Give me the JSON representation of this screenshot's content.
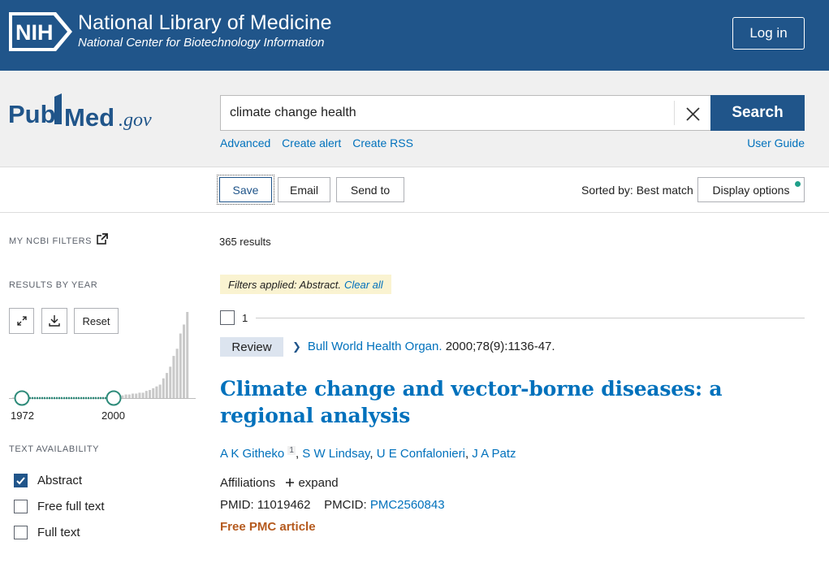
{
  "header": {
    "org_title": "National Library of Medicine",
    "org_subtitle": "National Center for Biotechnology Information",
    "login_label": "Log in",
    "nih_logo_text": "NIH"
  },
  "search": {
    "logo_text": "PubMed.gov",
    "query": "climate change health",
    "search_label": "Search",
    "links": [
      "Advanced",
      "Create alert",
      "Create RSS"
    ],
    "user_guide": "User Guide"
  },
  "actions": {
    "save": "Save",
    "email": "Email",
    "send_to": "Send to",
    "sorted_by": "Sorted by: Best match",
    "display_options": "Display options"
  },
  "sidebar": {
    "my_ncbi_filters": "MY NCBI FILTERS",
    "results_by_year": "RESULTS BY YEAR",
    "reset_label": "Reset",
    "year_start": "1972",
    "year_end": "2000",
    "text_availability": "TEXT AVAILABILITY",
    "filters": [
      {
        "label": "Abstract",
        "checked": true
      },
      {
        "label": "Free full text",
        "checked": false
      },
      {
        "label": "Full text",
        "checked": false
      }
    ]
  },
  "results": {
    "count": "365 results",
    "filters_applied": "Filters applied: Abstract.",
    "clear_all": "Clear all",
    "items": [
      {
        "number": "1",
        "badge": "Review",
        "journal": "Bull World Health Organ.",
        "citation_rest": "2000;78(9):1136-47.",
        "title": "Climate change and vector-borne diseases: a regional analysis",
        "authors": [
          {
            "name": "A K Githeko",
            "sup": "1"
          },
          {
            "name": "S W Lindsay"
          },
          {
            "name": "U E Confalonieri"
          },
          {
            "name": "J A Patz"
          }
        ],
        "affiliations": "Affiliations",
        "expand": "expand",
        "pmid_label": "PMID:",
        "pmid": "11019462",
        "pmcid_label": "PMCID:",
        "pmcid": "PMC2560843",
        "free_label": "Free PMC article"
      }
    ]
  },
  "histogram": {
    "bar_color": "#c9c9c9",
    "selected_range_color": "#2e8b7a",
    "values": [
      0,
      0,
      0,
      0,
      0,
      0,
      0,
      0,
      0,
      0,
      0,
      0,
      0,
      0,
      0,
      0,
      0,
      0,
      0,
      0,
      0,
      0,
      0,
      0,
      1,
      1,
      1,
      1,
      2,
      2,
      2,
      3,
      3,
      4,
      4,
      5,
      5,
      6,
      6,
      8,
      9,
      11,
      13,
      15,
      22,
      28,
      35,
      47,
      55,
      72,
      82,
      96
    ]
  },
  "colors": {
    "brand_blue": "#20558a",
    "link_blue": "#0071bc",
    "free_orange": "#b55a1e",
    "filter_chip_bg": "#faf3d1"
  }
}
